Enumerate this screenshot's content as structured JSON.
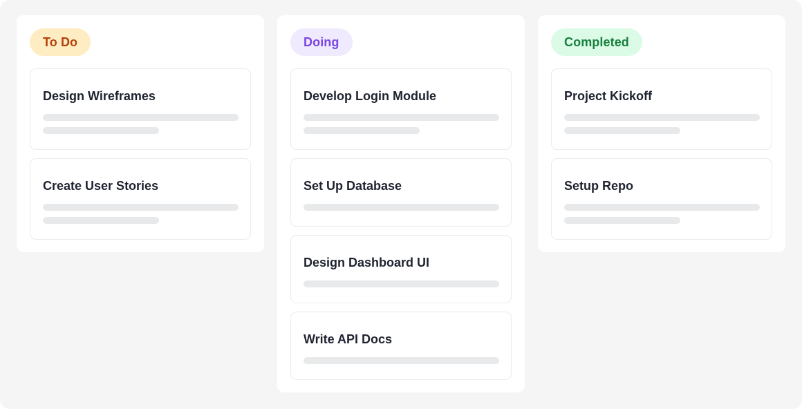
{
  "columns": [
    {
      "status": "To Do",
      "badge_bg": "#feedc2",
      "badge_color": "#b4410b",
      "cards": [
        {
          "title": "Design Wireframes",
          "placeholder_lines": 2
        },
        {
          "title": "Create User Stories",
          "placeholder_lines": 2
        }
      ]
    },
    {
      "status": "Doing",
      "badge_bg": "#efeafd",
      "badge_color": "#7a45e4",
      "cards": [
        {
          "title": "Develop Login Module",
          "placeholder_lines": 2
        },
        {
          "title": "Set Up Database",
          "placeholder_lines": 1
        },
        {
          "title": "Design Dashboard UI",
          "placeholder_lines": 1
        },
        {
          "title": "Write API Docs",
          "placeholder_lines": 1
        }
      ]
    },
    {
      "status": "Completed",
      "badge_bg": "#dcfbe7",
      "badge_color": "#16803c",
      "cards": [
        {
          "title": "Project Kickoff",
          "placeholder_lines": 2
        },
        {
          "title": "Setup Repo",
          "placeholder_lines": 2
        }
      ]
    }
  ]
}
